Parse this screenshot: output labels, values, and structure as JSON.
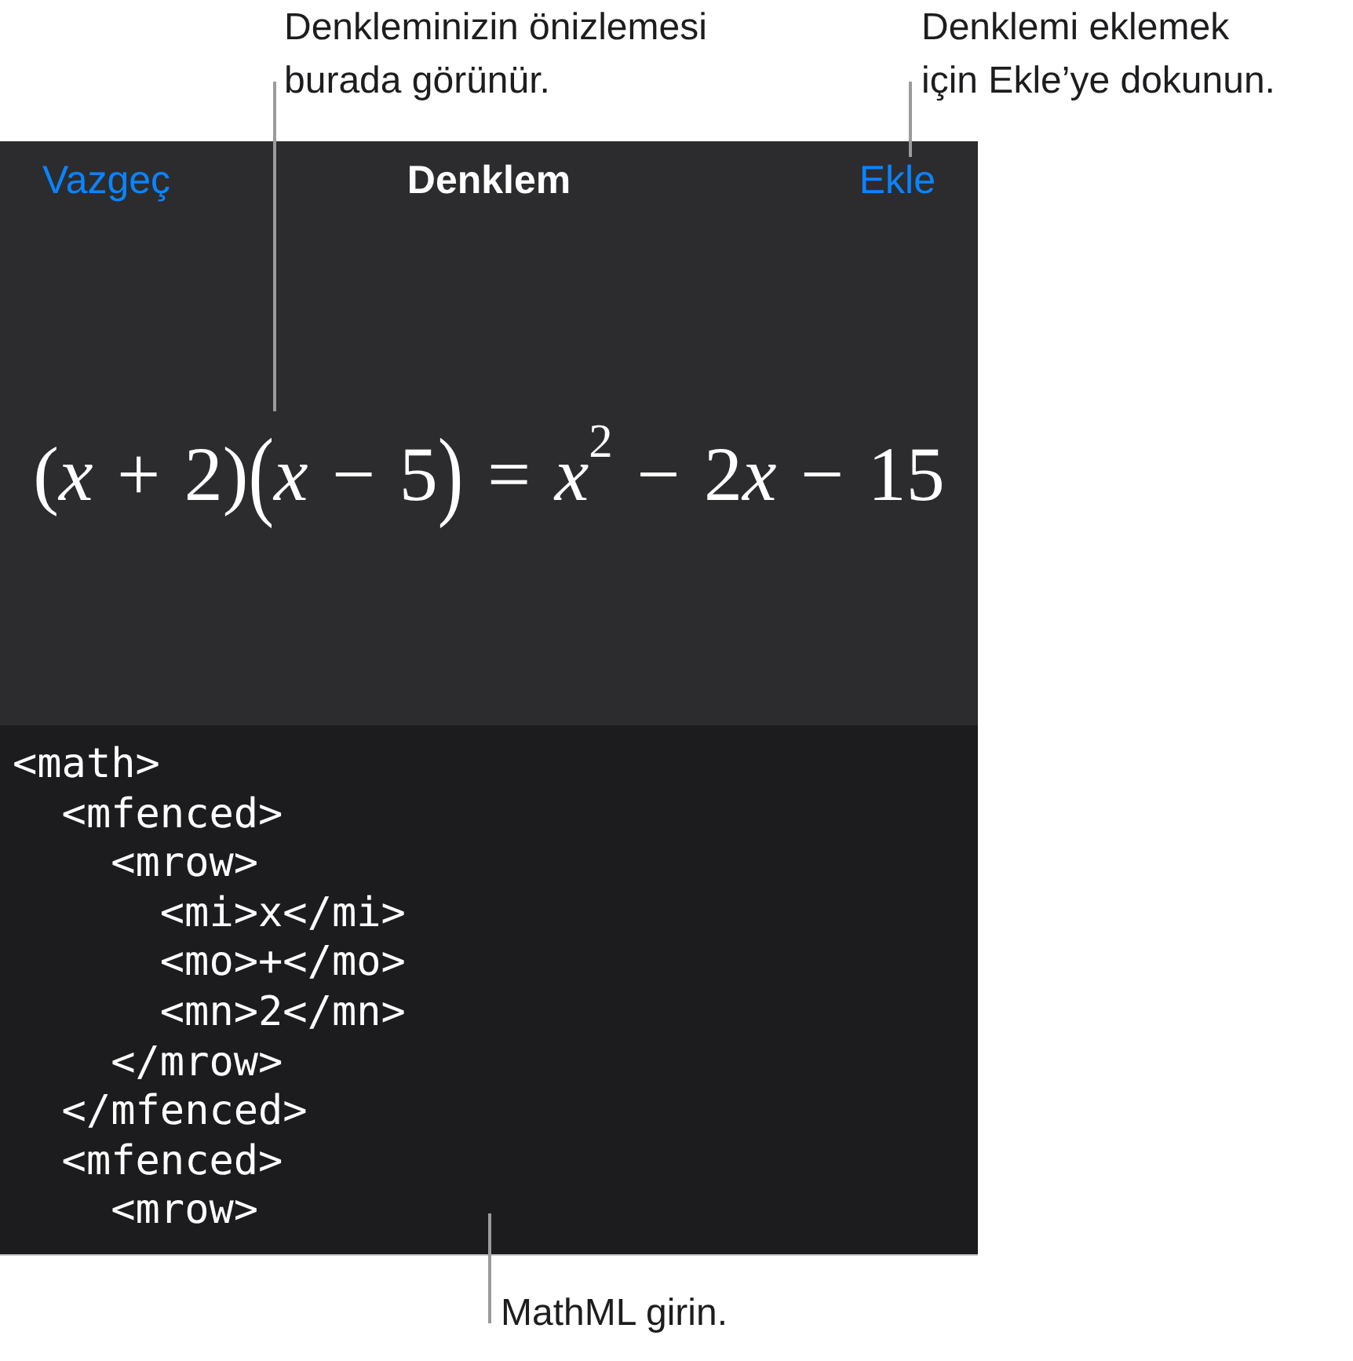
{
  "top_callouts": [
    {
      "text": "Denkleminizin önizlemesi\nburada görünür."
    },
    {
      "text": "Denklemi eklemek\niçin Ekle’ye dokunun."
    }
  ],
  "sheet": {
    "nav_bar": {
      "cancel": "Vazgeç",
      "title": "Denklem",
      "add": "Ekle"
    },
    "equation": [
      {
        "kind": "text",
        "text": "("
      },
      {
        "kind": "var",
        "text": "x"
      },
      {
        "kind": "text",
        "text": " + 2)"
      },
      {
        "kind": "tall",
        "text": "("
      },
      {
        "kind": "var",
        "text": "x"
      },
      {
        "kind": "text",
        "text": " − 5"
      },
      {
        "kind": "tall",
        "text": ")"
      },
      {
        "kind": "text",
        "text": " = "
      },
      {
        "kind": "var",
        "text": "x"
      },
      {
        "kind": "sup",
        "text": "2"
      },
      {
        "kind": "text",
        "text": " − 2"
      },
      {
        "kind": "var",
        "text": "x"
      },
      {
        "kind": "text",
        "text": " − 15"
      }
    ],
    "editor": {
      "lines": [
        {
          "text": "<math>",
          "children": [
            {
              "text": "<mfenced>",
              "children": [
                {
                  "text": "<mrow>",
                  "children": [
                    {
                      "text": "<mi>x</mi>"
                    },
                    {
                      "text": "<mo>+</mo>"
                    },
                    {
                      "text": "<mn>2</mn>"
                    }
                  ],
                  "close": "</mrow>"
                }
              ],
              "close": "</mfenced>"
            },
            {
              "text": "<mfenced>",
              "children": [
                {
                  "text": "<mrow>"
                }
              ]
            }
          ]
        }
      ]
    }
  },
  "bottom_callout": {
    "text": "MathML girin."
  }
}
